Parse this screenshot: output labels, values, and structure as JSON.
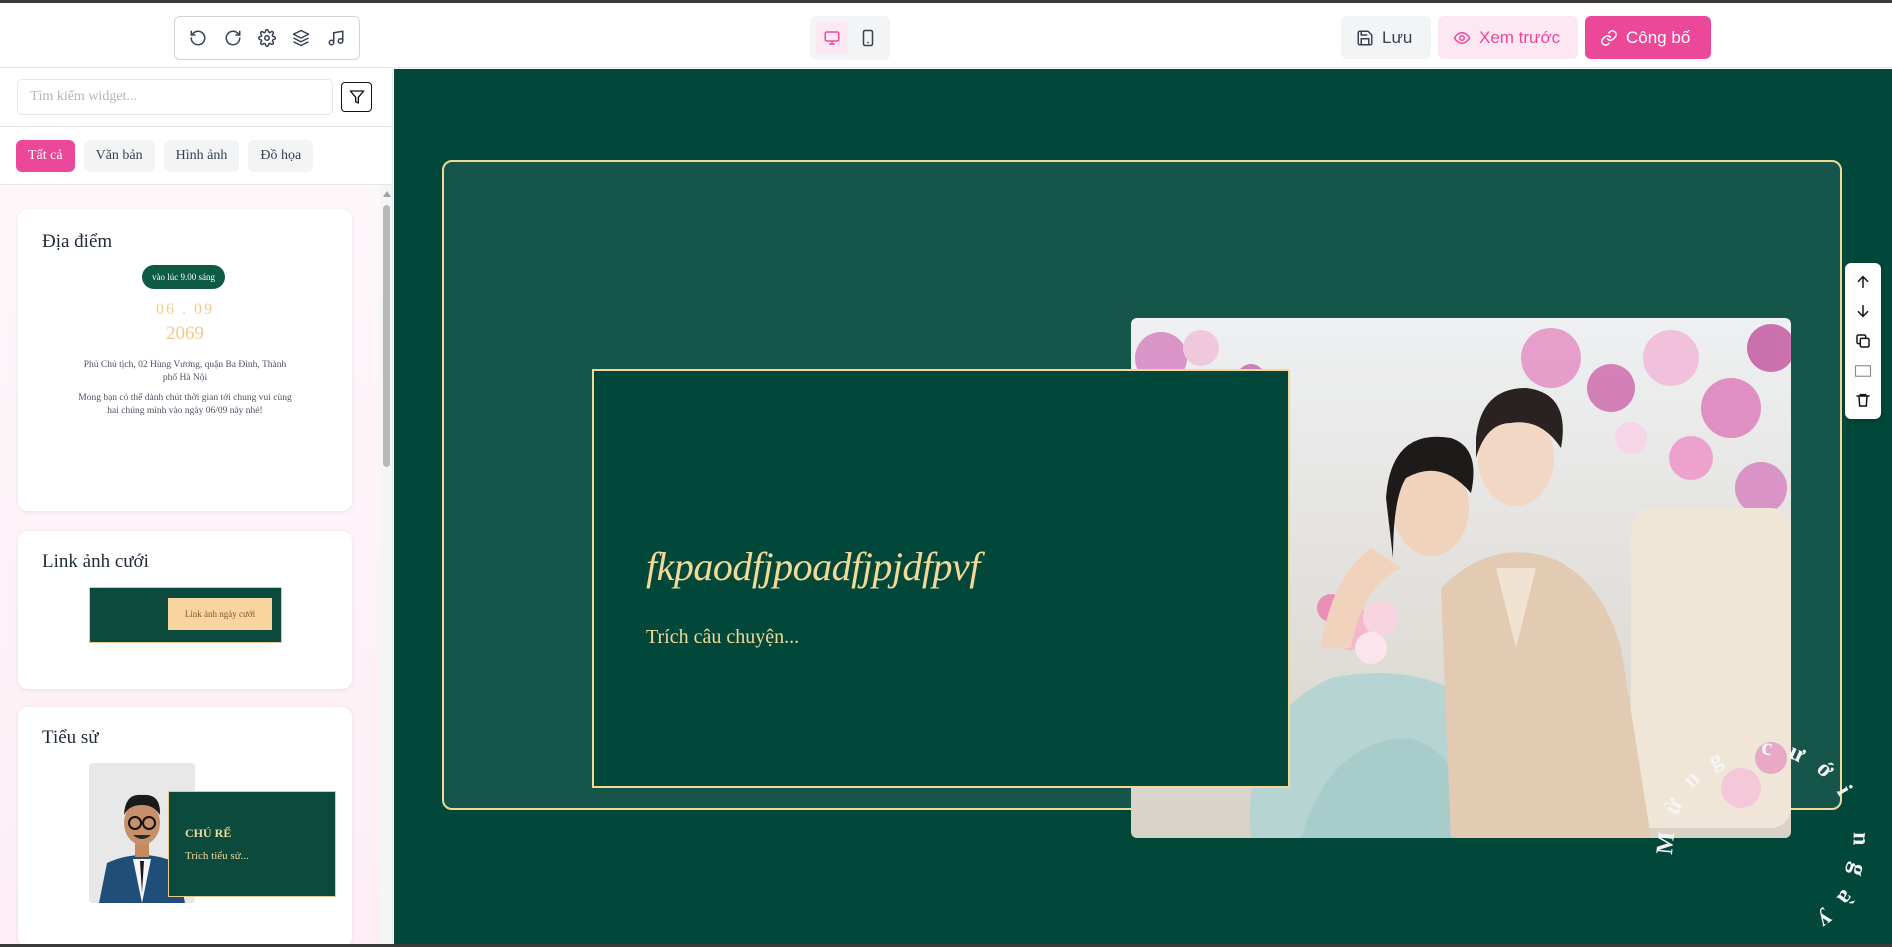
{
  "toolbar": {
    "tools": [
      "undo-icon",
      "redo-icon",
      "settings-icon",
      "layers-icon",
      "music-icon"
    ],
    "save_label": "Lưu",
    "preview_label": "Xem trước",
    "publish_label": "Công bố",
    "colors": {
      "pink": "#ec4899",
      "pink_light": "#fce7f3"
    }
  },
  "sidebar": {
    "search_placeholder": "Tìm kiếm widget...",
    "chips": [
      "Tất cả",
      "Văn bản",
      "Hình ảnh",
      "Đồ họa"
    ],
    "active_chip": "Tất cả",
    "widgets": {
      "location": {
        "title": "Địa điểm",
        "time_badge": "vào lúc 9.00 sáng",
        "date": "06 . 09",
        "year": "2069",
        "address": "Phủ Chủ tịch, 02 Hùng Vương, quận Ba Đình, Thành phố Hà Nội",
        "message": "Mong bạn có thể dành chút thời gian tới chung vui cùng hai chúng mình vào ngày 06/09 này nhé!"
      },
      "album_link": {
        "title": "Link ảnh cưới",
        "button_label": "Link ảnh ngày cưới"
      },
      "biography": {
        "title": "Tiểu sử",
        "role": "CHÚ RỂ",
        "excerpt": "Trích tiểu sử..."
      }
    }
  },
  "canvas": {
    "story_title": "fkpaodfjpoadfjpjdfpvf",
    "story_excerpt": "Trích câu chuyện...",
    "curved_text": "Mừng cưới ngày",
    "colors": {
      "background": "#02483a",
      "gold": "#f3d896"
    },
    "section_tools": [
      "arrow-up-icon",
      "arrow-down-icon",
      "duplicate-icon",
      "frame-icon",
      "trash-icon"
    ]
  }
}
